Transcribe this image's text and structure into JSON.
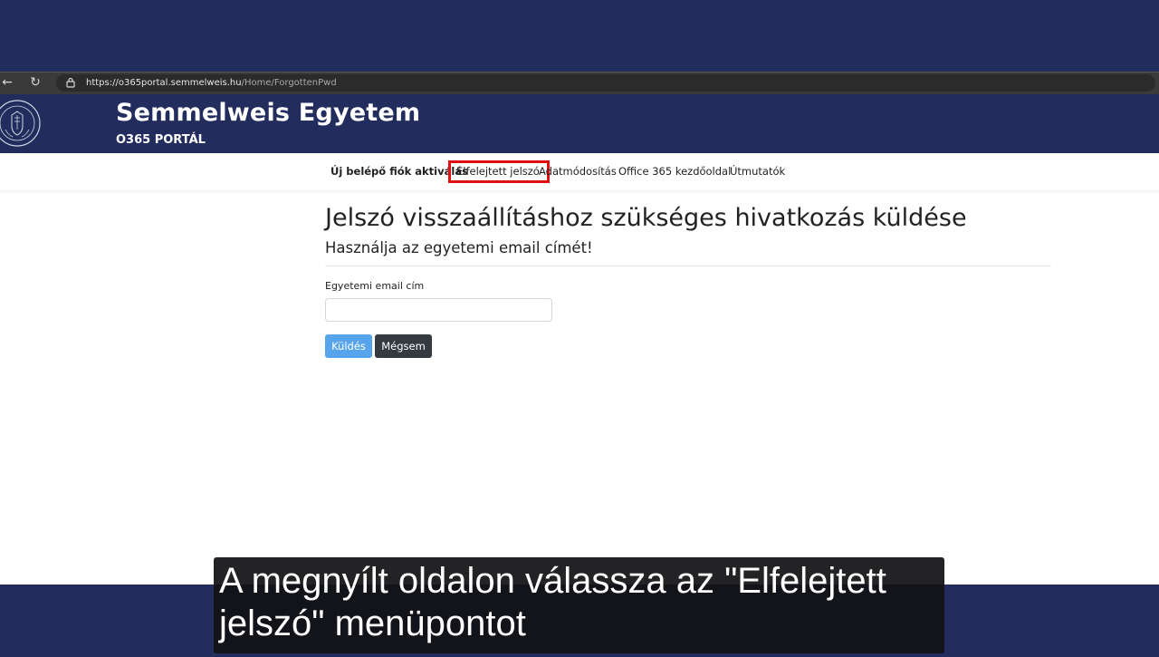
{
  "browser": {
    "url_host": "https://o365portal.semmelweis.hu",
    "url_path": "/Home/ForgottenPwd"
  },
  "header": {
    "title": "Semmelweis Egyetem",
    "subtitle": "O365 PORTÁL"
  },
  "nav": {
    "items": [
      {
        "label": "Új belépő fiók aktiválás"
      },
      {
        "label": "Elfelejtett jelszó"
      },
      {
        "label": "Adatmódosítás"
      },
      {
        "label": "Office 365 kezdőoldal"
      },
      {
        "label": "Útmutatók"
      }
    ]
  },
  "main": {
    "title": "Jelszó visszaállításhoz szükséges hivatkozás küldése",
    "subtitle": "Használja az egyetemi email címét!",
    "email_label": "Egyetemi email cím",
    "email_value": "",
    "send_label": "Küldés",
    "cancel_label": "Mégsem"
  },
  "caption": {
    "line1": "A megnyílt oldalon válassza az \"Elfelejtett",
    "line2": "jelszó\" menüpontot"
  },
  "colors": {
    "brand_navy": "#222d5e",
    "highlight_red": "#e01010",
    "send_button": "#56a5ec",
    "cancel_button": "#333a40"
  }
}
